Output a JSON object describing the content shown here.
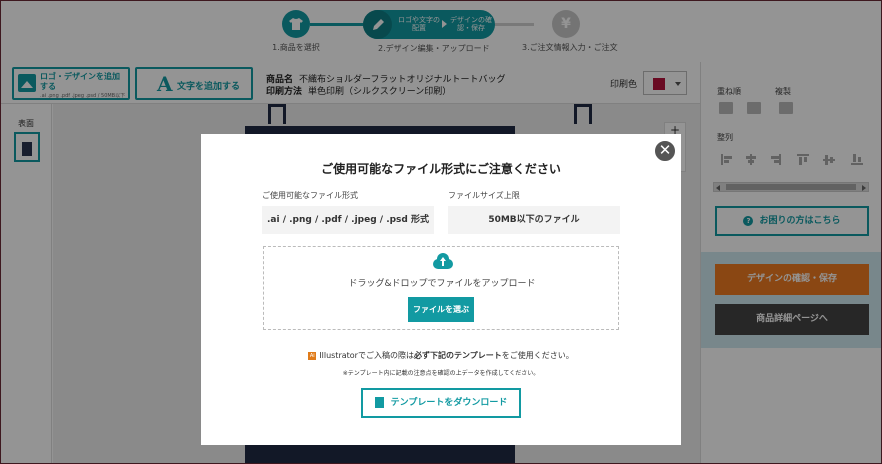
{
  "steps": {
    "step1_label": "1.商品を選択",
    "step2_pill_a": "ロゴや文字の配置",
    "step2_pill_b": "デザインの確認・保存",
    "step2_label": "2.デザイン編集・アップロード",
    "step3_label": "3.ご注文情報入力・ご注文",
    "step3_icon": "¥"
  },
  "toolbar": {
    "logo_button_label": "ロゴ・デザインを追加する",
    "logo_button_sub": ".ai .png .pdf .jpeg .psd / 50MB以下",
    "text_button_icon": "A",
    "text_button_label": "文字を追加する",
    "product_name_label": "商品名",
    "product_name": "不織布ショルダーフラットオリジナルトートバッグ",
    "print_method_label": "印刷方法",
    "print_method": "単色印刷（シルクスクリーン印刷）",
    "print_color_label": "印刷色",
    "print_color": "#b5123b"
  },
  "left_panel": {
    "side_label": "表面"
  },
  "right_panel": {
    "layer_label": "重ね順",
    "duplicate_label": "複製",
    "align_label": "整列",
    "help_icon": "?",
    "help_button": "お困りの方はこちら",
    "save_button": "デザインの確認・保存",
    "detail_button": "商品詳細ページへ"
  },
  "canvas": {
    "zoom_plus": "+"
  },
  "modal": {
    "close_icon": "✕",
    "title": "ご使用可能なファイル形式にご注意ください",
    "format_label": "ご使用可能なファイル形式",
    "format_value": ".ai / .png / .pdf / .jpeg / .psd 形式",
    "size_label": "ファイルサイズ上限",
    "size_value": "50MB以下のファイル",
    "drop_text": "ドラッグ&ドロップでファイルをアップロード",
    "select_button": "ファイルを選ぶ",
    "ai_badge": "Ai",
    "note_pre": "Illustratorでご入稿の際は",
    "note_bold": "必ず下記のテンプレート",
    "note_post": "をご使用ください。",
    "note_small": "※テンプレート内に記載の注意点を確認の上データを作成してください。",
    "download_button": "テンプレートをダウンロード"
  }
}
